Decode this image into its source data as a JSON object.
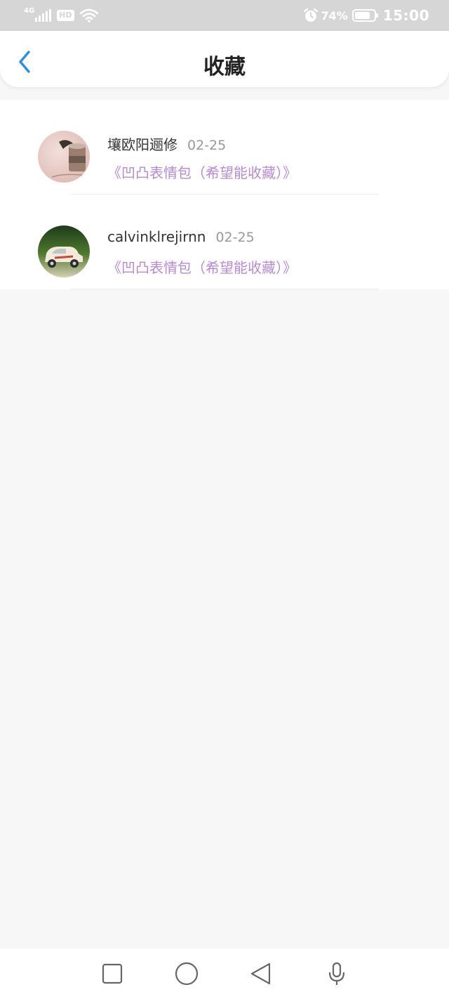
{
  "status_bar": {
    "network_type": "4G",
    "hd_label": "HD",
    "battery_percent": "74%",
    "time": "15:00",
    "icons": [
      "signal-icon",
      "wifi-icon",
      "alarm-icon",
      "battery-icon"
    ]
  },
  "header": {
    "title": "收藏",
    "back_icon": "chevron-left-icon",
    "accent_color": "#2b8fe0"
  },
  "favorites": [
    {
      "username": "壤欧阳逦修",
      "date": "02-25",
      "title": "《凹凸表情包（希望能收藏）》",
      "avatar": "cup-photo-avatar"
    },
    {
      "username": "calvinklrejirnn",
      "date": "02-25",
      "title": "《凹凸表情包（希望能收藏）》",
      "avatar": "toy-car-photo-avatar"
    }
  ],
  "colors": {
    "status_bar_bg": "#d6d6d6",
    "title_link": "#b68ad6",
    "date_text": "#999999",
    "page_bg": "#f8f7f8"
  },
  "nav_bar": {
    "buttons": [
      "recent-apps-icon",
      "home-icon",
      "back-icon",
      "microphone-icon"
    ]
  }
}
